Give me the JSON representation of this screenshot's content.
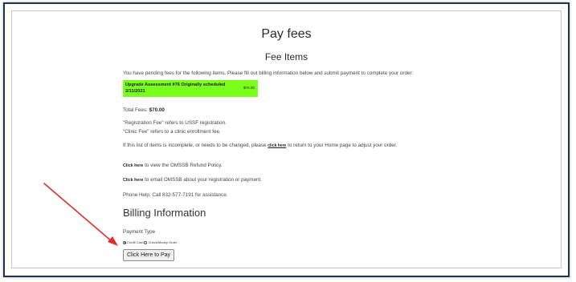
{
  "header": {
    "page_title": "Pay fees",
    "section_title": "Fee Items"
  },
  "intro_text": "You have pending fees for the following items. Please fill out billing information below and submit payment to complete your order:",
  "fee_item": {
    "name": "Upgrade Assessment #76 Originally scheduled 2/11/2021",
    "amount": "$70.00"
  },
  "total": {
    "label": "Total Fees:",
    "value": "$70.00"
  },
  "notes": {
    "registration": "\"Registration Fee\" refers to USSF registration.",
    "clinic": "\"Clinic Fee\" refers to a clinic enrollment fee."
  },
  "incomplete": {
    "prefix": "If this list of items is incomplete, or needs to be changed, please",
    "link": "click here",
    "suffix": "to return to your Home page to adjust your order."
  },
  "refund": {
    "link": "Click here",
    "text": "to view the OMSSB Refund Policy."
  },
  "email": {
    "link": "Click here",
    "text": "to email OMSSB about your registration or payment."
  },
  "phone_help": "Phone Help: Call 832-577-7191 for assistance.",
  "billing": {
    "title": "Billing Information",
    "payment_type_label": "Payment Type",
    "options": [
      "Credit Card",
      "Check/Money Order"
    ],
    "selected": "Credit Card",
    "pay_button": "Click Here to Pay"
  },
  "colors": {
    "fee_highlight": "#7bff1d",
    "annotation_arrow": "#d9302c",
    "frame_border": "#1f3350"
  }
}
